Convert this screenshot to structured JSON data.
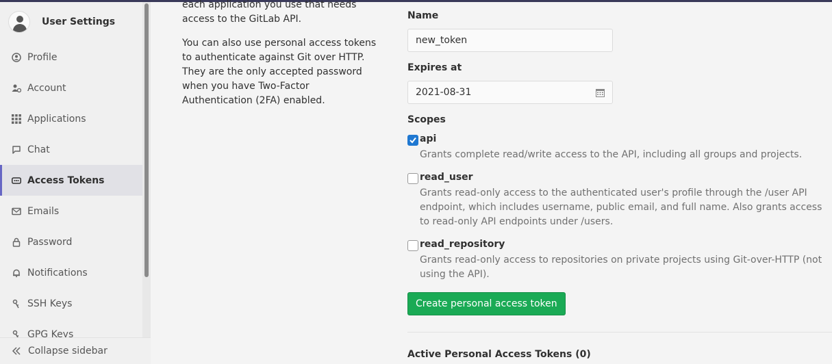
{
  "sidebar": {
    "title": "User Settings",
    "items": [
      {
        "label": "Profile",
        "icon": "profile-icon",
        "active": false
      },
      {
        "label": "Account",
        "icon": "account-icon",
        "active": false
      },
      {
        "label": "Applications",
        "icon": "applications-icon",
        "active": false
      },
      {
        "label": "Chat",
        "icon": "chat-icon",
        "active": false
      },
      {
        "label": "Access Tokens",
        "icon": "token-icon",
        "active": true
      },
      {
        "label": "Emails",
        "icon": "mail-icon",
        "active": false
      },
      {
        "label": "Password",
        "icon": "lock-icon",
        "active": false
      },
      {
        "label": "Notifications",
        "icon": "bell-icon",
        "active": false
      },
      {
        "label": "SSH Keys",
        "icon": "key-icon",
        "active": false
      },
      {
        "label": "GPG Keys",
        "icon": "key-icon",
        "active": false
      }
    ],
    "collapse_label": "Collapse sidebar"
  },
  "description": {
    "p1": "each application you use that needs access to the GitLab API.",
    "p2": "You can also use personal access tokens to authenticate against Git over HTTP. They are the only accepted password when you have Two-Factor Authentication (2FA) enabled."
  },
  "form": {
    "name_label": "Name",
    "name_value": "new_token",
    "expires_label": "Expires at",
    "expires_value": "2021-08-31",
    "scopes_label": "Scopes",
    "scopes": [
      {
        "name": "api",
        "checked": true,
        "description": "Grants complete read/write access to the API, including all groups and projects."
      },
      {
        "name": "read_user",
        "checked": false,
        "description": "Grants read-only access to the authenticated user's profile through the /user API endpoint, which includes username, public email, and full name. Also grants access to read-only API endpoints under /users."
      },
      {
        "name": "read_repository",
        "checked": false,
        "description": "Grants read-only access to repositories on private projects using Git-over-HTTP (not using the API)."
      }
    ],
    "create_button": "Create personal access token",
    "active_tokens_title": "Active Personal Access Tokens (0)"
  },
  "colors": {
    "accent": "#6666c4",
    "create_button": "#1aaa55",
    "checkbox_checked": "#1f78d1"
  }
}
